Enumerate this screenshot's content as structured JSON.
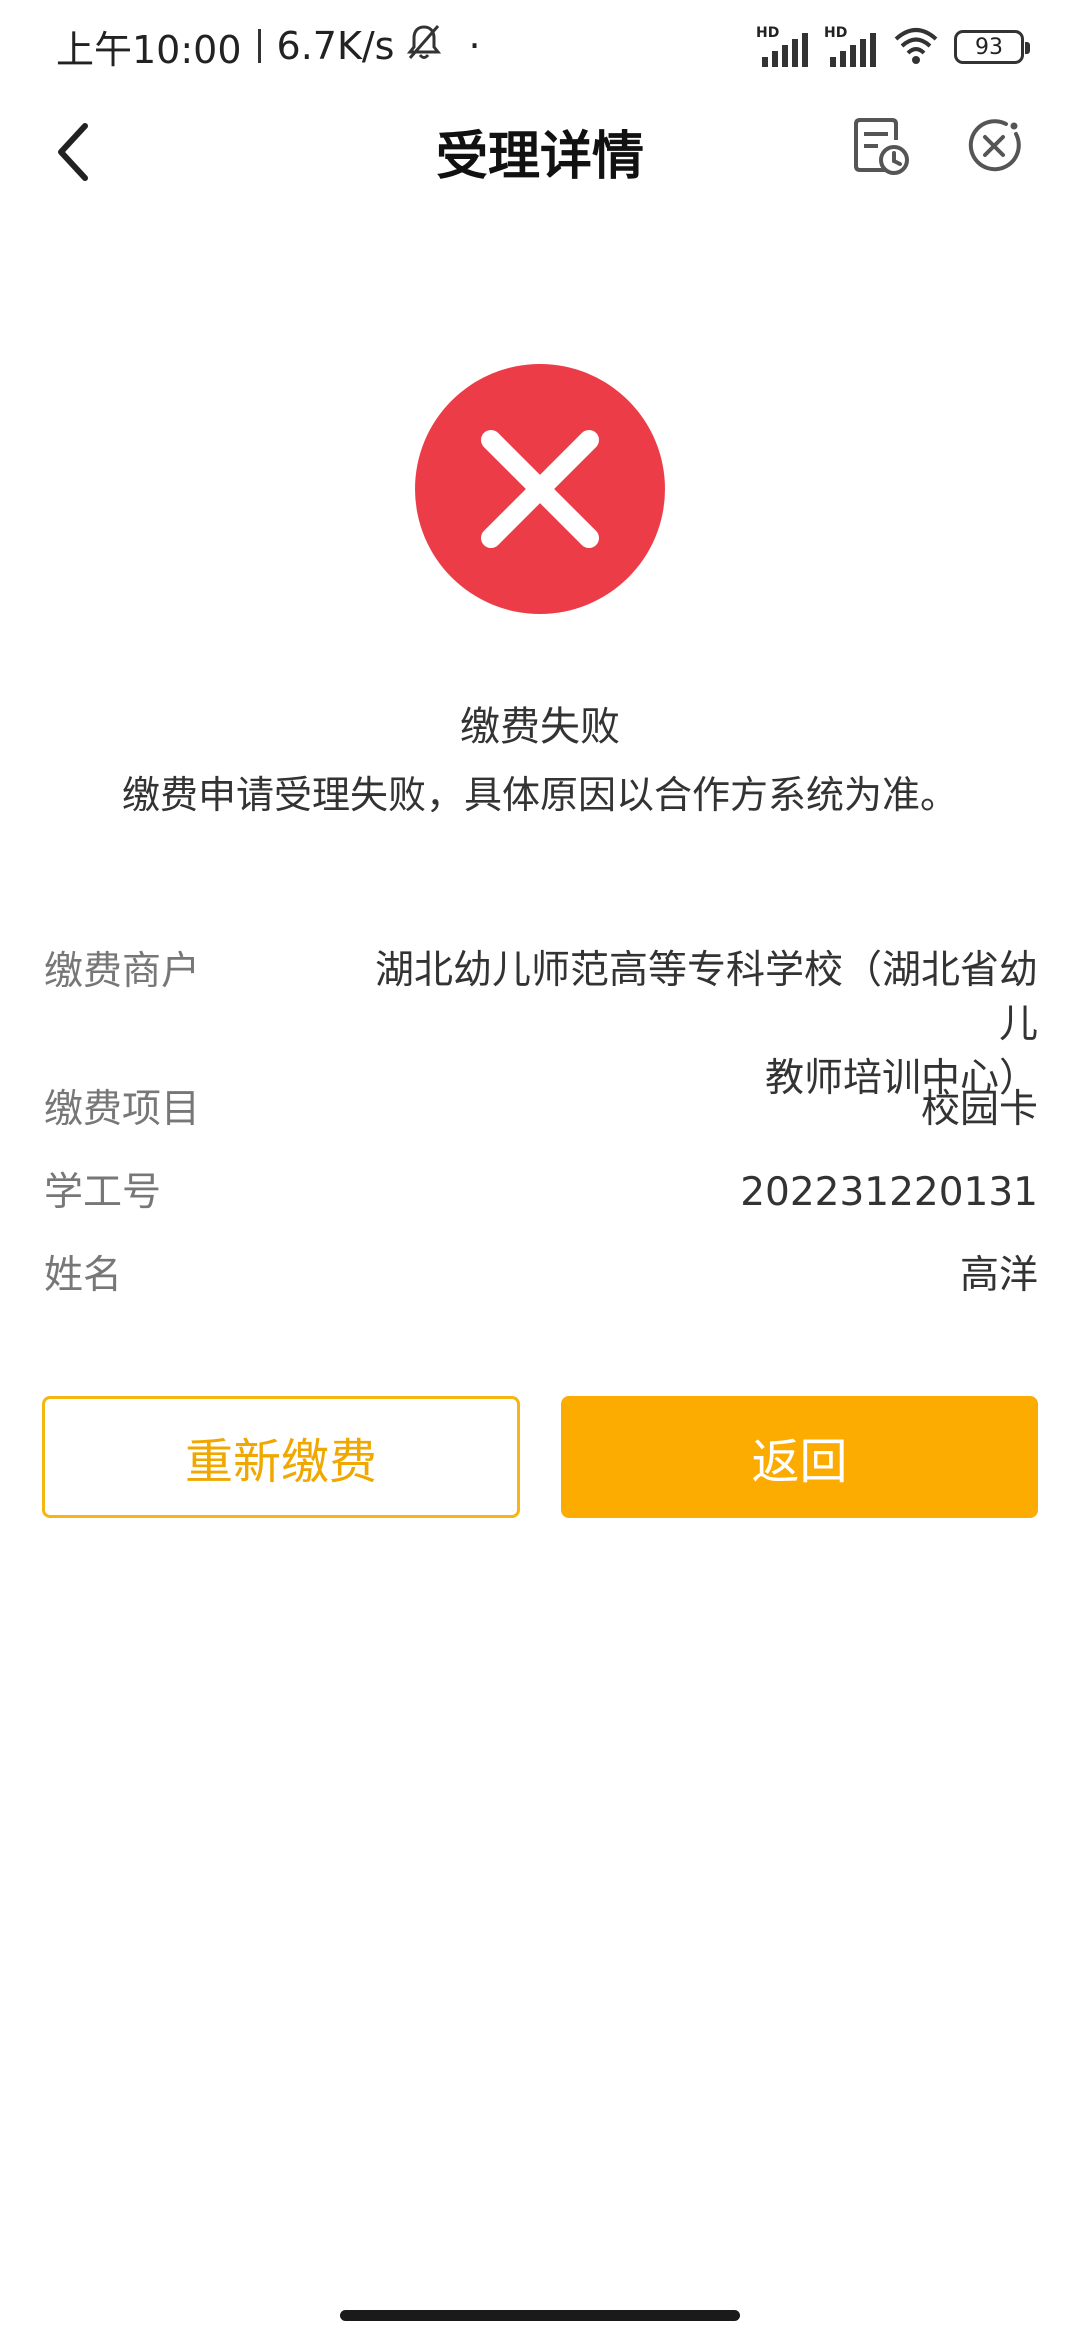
{
  "status_bar": {
    "time": "上午10:00",
    "network_speed": "6.7K/s",
    "dot": "·",
    "signal1_label": "HD",
    "signal2_label": "HD",
    "battery_level": "93"
  },
  "nav": {
    "title": "受理详情",
    "back_icon": "chevron-left-icon",
    "record_icon": "document-clock-icon",
    "close_icon": "close-circle-icon"
  },
  "result": {
    "status_icon": "error-x-icon",
    "status_color": "#ec3c48",
    "title": "缴费失败",
    "description": "缴费申请受理失败，具体原因以合作方系统为准。"
  },
  "details": {
    "merchant_label": "缴费商户",
    "merchant_value_line1": "湖北幼儿师范高等专科学校（湖北省幼儿",
    "merchant_value_line2": "教师培训中心）",
    "project_label": "缴费项目",
    "project_value": "校园卡",
    "id_label": "学工号",
    "id_value": "202231220131",
    "name_label": "姓名",
    "name_value": "高洋"
  },
  "buttons": {
    "repay_label": "重新缴费",
    "back_label": "返回",
    "accent_color": "#fcab00"
  }
}
